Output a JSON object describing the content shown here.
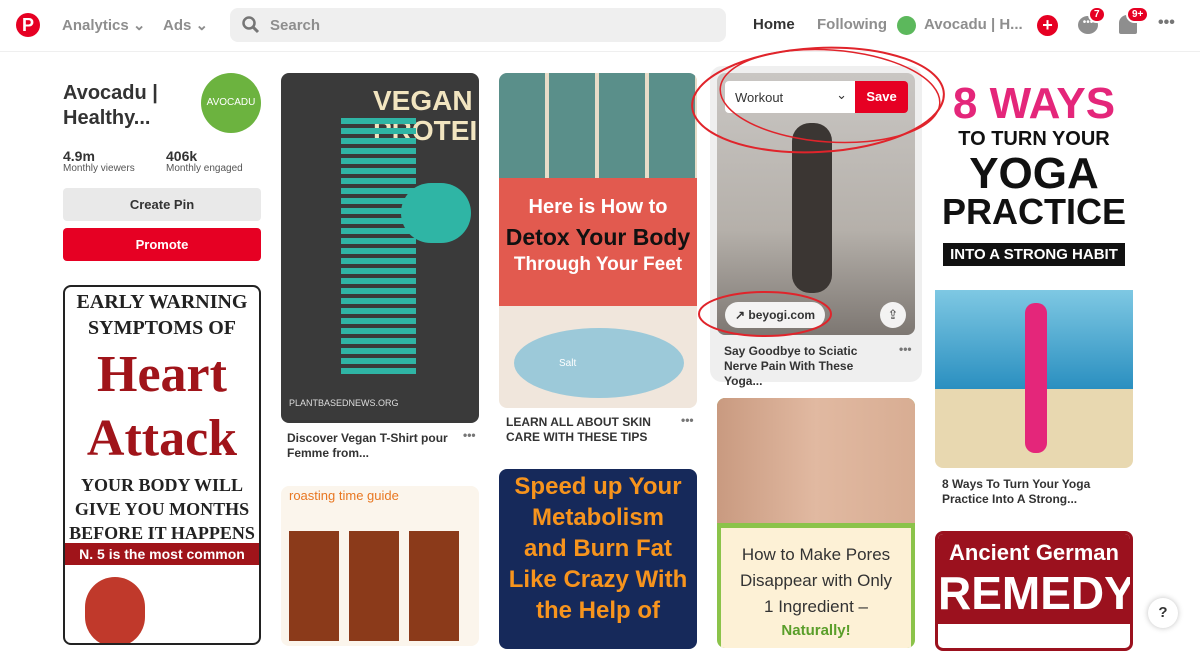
{
  "header": {
    "nav": [
      {
        "label": "Analytics"
      },
      {
        "label": "Ads"
      }
    ],
    "search_placeholder": "Search",
    "home": "Home",
    "following": "Following",
    "account": "Avocadu | H...",
    "messages_badge": "7",
    "notifications_badge": "9+",
    "brand_color": "#e60023"
  },
  "profile": {
    "name": "Avocadu | Healthy...",
    "avatar_text": "AVOCADU",
    "viewers": "4.9m",
    "viewers_label": "Monthly viewers",
    "engaged": "406k",
    "engaged_label": "Monthly engaged",
    "create_pin": "Create Pin",
    "promote": "Promote"
  },
  "pins": [
    {
      "image_text": [
        "EARLY WARNING",
        "SYMPTOMS OF",
        "Heart",
        "Attack",
        "YOUR BODY WILL",
        "GIVE YOU MONTHS",
        "BEFORE IT HAPPENS",
        "N. 5 is the most common"
      ]
    },
    {
      "image_text": [
        "VEGAN",
        "PROTEIN",
        "PLANTBASEDNEWS.ORG"
      ],
      "caption": "Discover Vegan T-Shirt pour Femme from..."
    },
    {
      "image_text": [
        "roasting time guide"
      ]
    },
    {
      "image_text": [
        "Here is How to",
        "Detox Your Body",
        "Through Your Feet",
        "Salt"
      ],
      "caption": "LEARN ALL ABOUT SKIN CARE WITH THESE TIPS"
    },
    {
      "image_text": [
        "Speed up Your",
        "Metabolism",
        "and Burn Fat",
        "Like Crazy With",
        "the Help of"
      ]
    },
    {
      "board": "Workout",
      "save": "Save",
      "link": "beyogi.com",
      "caption": "Say Goodbye to Sciatic Nerve Pain With These Yoga..."
    },
    {
      "image_text": [
        "How to Make Pores",
        "Disappear with Only",
        "1 Ingredient –",
        "Naturally!"
      ]
    },
    {
      "image_text": [
        "8 WAYS",
        "TO TURN YOUR",
        "YOGA",
        "PRACTICE",
        "INTO A STRONG HABIT"
      ],
      "caption": "8 Ways To Turn Your Yoga Practice Into A Strong..."
    },
    {
      "image_text": [
        "Ancient German",
        "REMEDY"
      ]
    }
  ],
  "help": "?"
}
